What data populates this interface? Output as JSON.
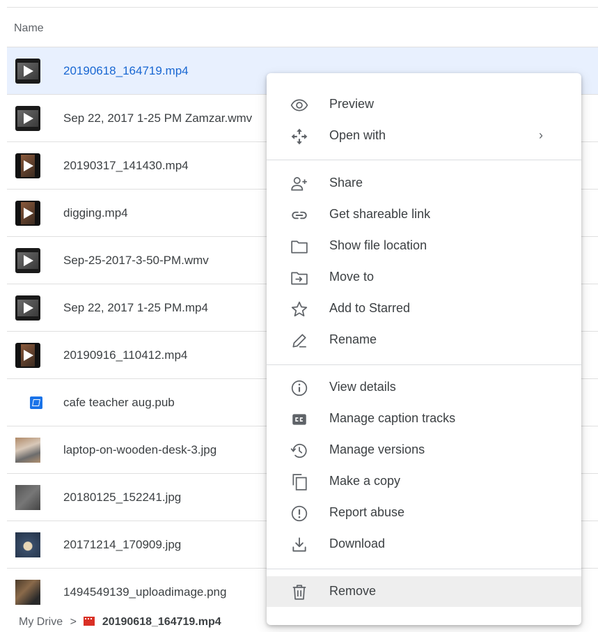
{
  "header": {
    "name_column": "Name"
  },
  "files": [
    {
      "name": "20190618_164719.mp4",
      "thumb": "video",
      "selected": true
    },
    {
      "name": "Sep 22, 2017 1-25 PM Zamzar.wmv",
      "thumb": "video"
    },
    {
      "name": "20190317_141430.mp4",
      "thumb": "video-portrait"
    },
    {
      "name": "digging.mp4",
      "thumb": "video-portrait"
    },
    {
      "name": "Sep-25-2017-3-50-PM.wmv",
      "thumb": "video"
    },
    {
      "name": "Sep 22, 2017 1-25 PM.mp4",
      "thumb": "video"
    },
    {
      "name": "20190916_110412.mp4",
      "thumb": "video-portrait"
    },
    {
      "name": "cafe teacher aug.pub",
      "thumb": "pub-icon"
    },
    {
      "name": "laptop-on-wooden-desk-3.jpg",
      "thumb": "image"
    },
    {
      "name": "20180125_152241.jpg",
      "thumb": "image"
    },
    {
      "name": "20171214_170909.jpg",
      "thumb": "image"
    },
    {
      "name": "1494549139_uploadimage.png",
      "thumb": "image"
    }
  ],
  "breadcrumb": {
    "root": "My Drive",
    "separator": ">",
    "file": "20190618_164719.mp4",
    "file_icon": "video-file-icon"
  },
  "context_menu": {
    "items": [
      {
        "label": "Preview",
        "icon": "eye-icon"
      },
      {
        "label": "Open with",
        "icon": "move-arrows-icon",
        "submenu": "›"
      },
      {
        "label": "Share",
        "icon": "person-add-icon"
      },
      {
        "label": "Get shareable link",
        "icon": "link-icon"
      },
      {
        "label": "Show file location",
        "icon": "folder-icon"
      },
      {
        "label": "Move to",
        "icon": "folder-move-icon"
      },
      {
        "label": "Add to Starred",
        "icon": "star-icon"
      },
      {
        "label": "Rename",
        "icon": "pencil-icon"
      },
      {
        "label": "View details",
        "icon": "info-icon"
      },
      {
        "label": "Manage caption tracks",
        "icon": "closed-caption-icon"
      },
      {
        "label": "Manage versions",
        "icon": "history-icon"
      },
      {
        "label": "Make a copy",
        "icon": "copy-icon"
      },
      {
        "label": "Report abuse",
        "icon": "report-icon"
      },
      {
        "label": "Download",
        "icon": "download-icon"
      },
      {
        "label": "Remove",
        "icon": "trash-icon",
        "highlighted": true
      }
    ]
  },
  "colors": {
    "selected_row_bg": "#e8f0fe",
    "selected_text": "#1967d2",
    "hover_bg": "#eeeeee",
    "divider": "#e0e0e0"
  }
}
